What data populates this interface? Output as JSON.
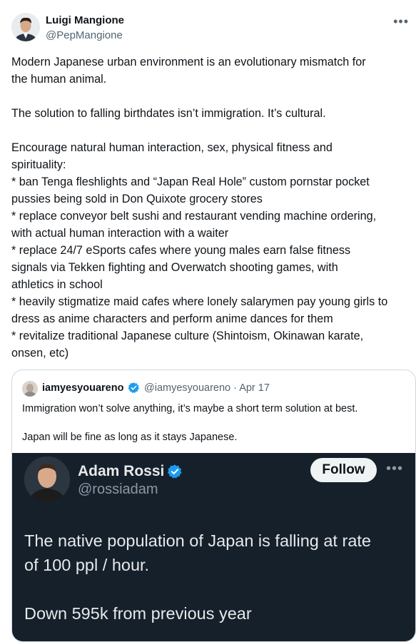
{
  "author": {
    "name": "Luigi Mangione",
    "handle": "@PepMangione"
  },
  "more_icon": "more-horizontal-icon",
  "tweet": {
    "paragraphs": [
      "Modern Japanese urban environment is an evolutionary mismatch for",
      "the human animal.",
      "",
      "The solution to falling birthdates isn’t immigration. It’s cultural.",
      "",
      "Encourage natural human interaction, sex, physical fitness and",
      "spirituality:",
      "* ban Tenga fleshlights and “Japan Real Hole” custom pornstar pocket",
      "pussies being sold in Don Quixote grocery stores",
      "* replace conveyor belt sushi and restaurant vending machine ordering,",
      "with actual human interaction with a waiter",
      "* replace 24/7 eSports cafes where young males earn false fitness",
      "signals via Tekken fighting and Overwatch shooting games, with",
      "athletics in school",
      "* heavily stigmatize maid cafes where lonely salarymen pay young girls to",
      "dress as anime characters and perform anime dances for them",
      "* revitalize traditional Japanese culture (Shintoism, Okinawan karate,",
      "onsen, etc)"
    ]
  },
  "quote": {
    "name": "iamyesyouareno",
    "handle_date": "@iamyesyouareno · Apr 17",
    "lines": [
      "Immigration won’t solve anything, it’s maybe a short term solution at best.",
      "",
      "Japan will be fine as long as it stays Japanese."
    ],
    "media": {
      "name": "Adam Rossi",
      "handle": "@rossiadam",
      "follow_label": "Follow",
      "lines": [
        "The native population of Japan is falling at rate",
        "of 100 ppl / hour.",
        "",
        "Down 595k from previous year"
      ]
    }
  },
  "colors": {
    "verified": "#1d9bf0",
    "media_bg": "#15202b"
  }
}
